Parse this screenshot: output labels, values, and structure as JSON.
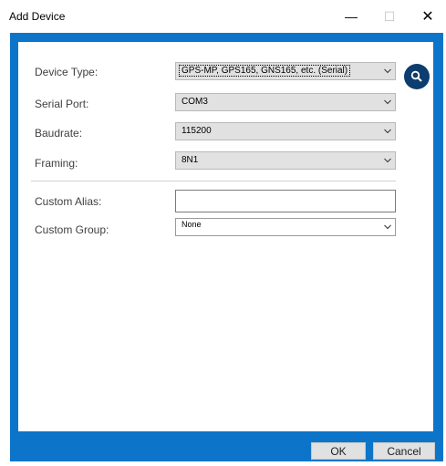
{
  "window": {
    "title": "Add Device",
    "minimize_glyph": "—",
    "maximize_glyph": "☐",
    "close_glyph": "✕"
  },
  "form": {
    "device_type": {
      "label": "Device Type:",
      "value": "GPS-MP, GPS165, GNS165, etc. (Serial)"
    },
    "serial_port": {
      "label": "Serial Port:",
      "value": "COM3"
    },
    "baudrate": {
      "label": "Baudrate:",
      "value": "115200"
    },
    "framing": {
      "label": "Framing:",
      "value": "8N1"
    },
    "custom_alias": {
      "label": "Custom Alias:",
      "value": ""
    },
    "custom_group": {
      "label": "Custom Group:",
      "value": "None"
    }
  },
  "search_icon": "search-icon",
  "buttons": {
    "ok": "OK",
    "cancel": "Cancel"
  },
  "colors": {
    "frame": "#0d75c9",
    "search_button": "#0d3c6e"
  }
}
